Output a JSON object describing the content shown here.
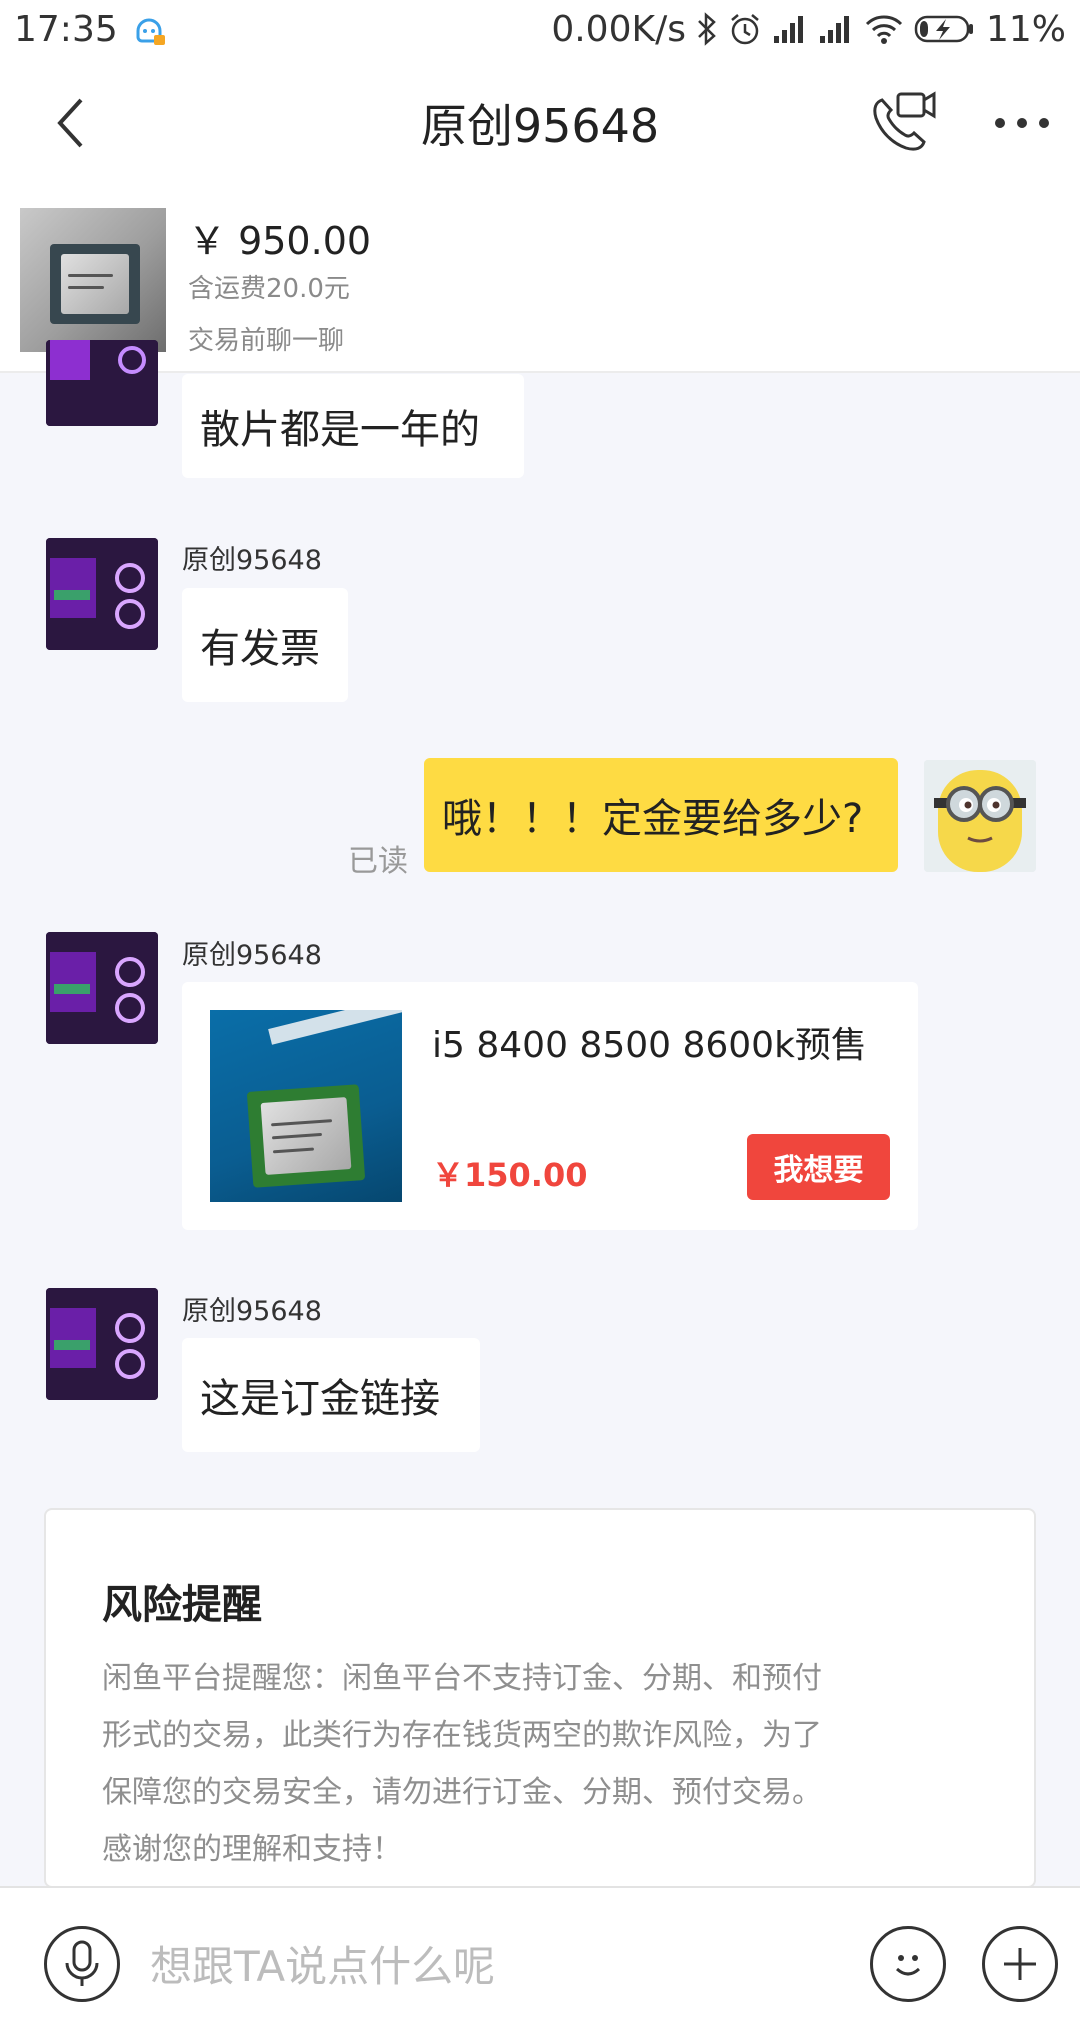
{
  "status_bar": {
    "time": "17:35",
    "net_speed": "0.00K/s",
    "battery": "11%"
  },
  "header": {
    "title": "原创95648",
    "back_icon": "chevron-left-icon",
    "video_call_icon": "phone-video-icon",
    "more_icon": "more-dots-icon"
  },
  "product": {
    "price": "￥ 950.00",
    "shipping": "含运费20.0元",
    "chat_hint": "交易前聊一聊"
  },
  "messages": [
    {
      "from": "seller",
      "text": "散片都是一年的"
    },
    {
      "from": "seller",
      "sender": "原创95648",
      "text": "有发票"
    },
    {
      "from": "me",
      "text": "哦！！！定金要给多少?",
      "status": "已读"
    },
    {
      "from": "seller",
      "sender": "原创95648",
      "type": "item",
      "item": {
        "title": "i5 8400 8500 8600k预售",
        "price": "￥150.00",
        "button": "我想要"
      }
    },
    {
      "from": "seller",
      "sender": "原创95648",
      "text": "这是订金链接"
    }
  ],
  "risk_notice": {
    "title": "风险提醒",
    "lines": [
      "闲鱼平台提醒您：闲鱼平台不支持订金、分期、和预付",
      "形式的交易，此类行为存在钱货两空的欺诈风险，为了",
      "保障您的交易安全，请勿进行订金、分期、预付交易。",
      "感谢您的理解和支持！"
    ]
  },
  "input_bar": {
    "placeholder": "想跟TA说点什么呢",
    "voice_icon": "microphone-icon",
    "emoji_icon": "smiley-icon",
    "plus_icon": "plus-icon"
  },
  "colors": {
    "accent_yellow": "#fedb43",
    "price_red": "#f0463d",
    "background": "#f5f6fb"
  }
}
